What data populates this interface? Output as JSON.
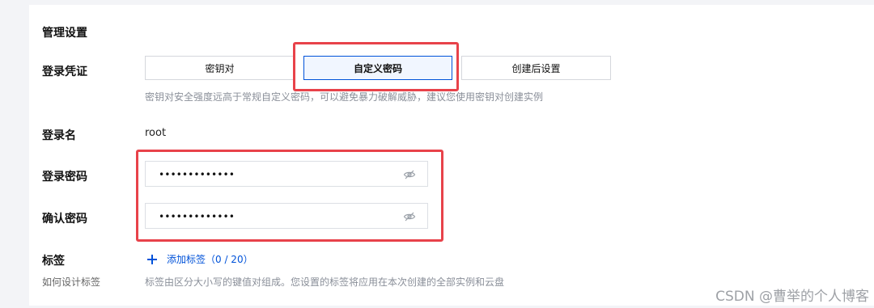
{
  "section_title": "管理设置",
  "login_credential": {
    "label": "登录凭证",
    "options": [
      "密钥对",
      "自定义密码",
      "创建后设置"
    ],
    "selected": "自定义密码",
    "hint": "密钥对安全强度远高于常规自定义密码，可以避免暴力破解威胁，建议您使用密钥对创建实例"
  },
  "login_name": {
    "label": "登录名",
    "value": "root"
  },
  "login_password": {
    "label": "登录密码",
    "value": "•••••••••••••",
    "icon": "eye-off-icon"
  },
  "confirm_password": {
    "label": "确认密码",
    "value": "•••••••••••••",
    "icon": "eye-off-icon"
  },
  "tags": {
    "label": "标签",
    "sub_label": "如何设计标签",
    "add_label": "添加标签（0 / 20）",
    "hint": "标签由区分大小写的键值对组成。您设置的标签将应用在本次创建的全部实例和云盘"
  },
  "highlight_color": "#e8424a",
  "accent_color": "#0052d9",
  "watermark": "CSDN @曹举的个人博客"
}
